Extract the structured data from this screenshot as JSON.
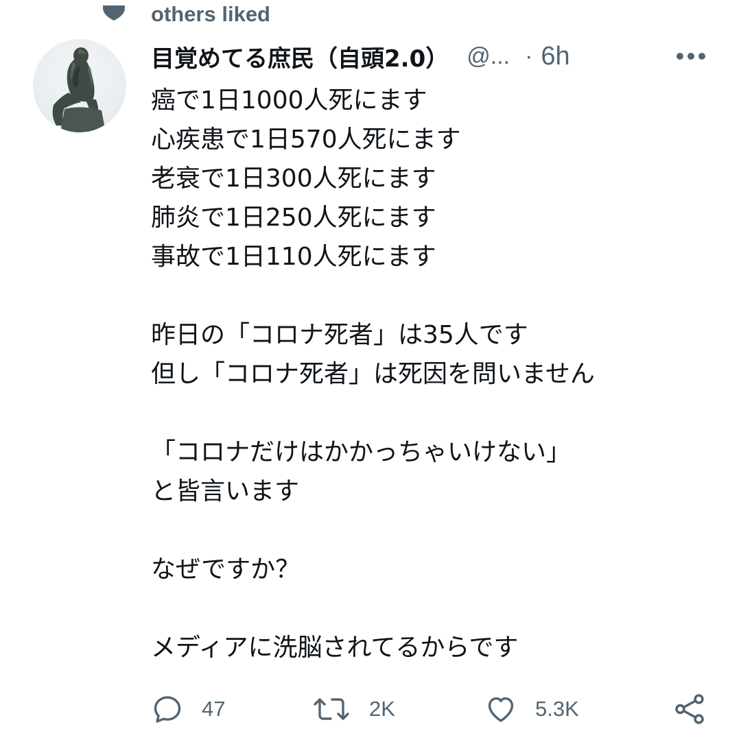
{
  "social_context": {
    "text": "others liked",
    "icon": "heart-icon"
  },
  "tweet": {
    "author": {
      "display_name": "目覚めてる庶民（自頭2.0）",
      "handle": "@...",
      "avatar_icon": "thinker-statue-avatar"
    },
    "separator": "·",
    "time": "6h",
    "more_icon": "more-horizontal-icon",
    "lines": [
      "癌で1日1000人死にます",
      "心疾患で1日570人死にます",
      "老衰で1日300人死にます",
      "肺炎で1日250人死にます",
      "事故で1日110人死にます",
      "",
      "昨日の「コロナ死者」は35人です",
      "但し「コロナ死者」は死因を問いません",
      "",
      "「コロナだけはかかっちゃいけない」",
      "と皆言います",
      "",
      "なぜですか？",
      "",
      "メディアに洗脳されてるからです"
    ]
  },
  "actions": {
    "reply": {
      "icon": "reply-icon",
      "count": "47"
    },
    "retweet": {
      "icon": "retweet-icon",
      "count": "2K"
    },
    "like": {
      "icon": "like-icon",
      "count": "5.3K"
    },
    "share": {
      "icon": "share-icon"
    }
  },
  "colors": {
    "text_primary": "#0f1419",
    "text_secondary": "#536471"
  }
}
